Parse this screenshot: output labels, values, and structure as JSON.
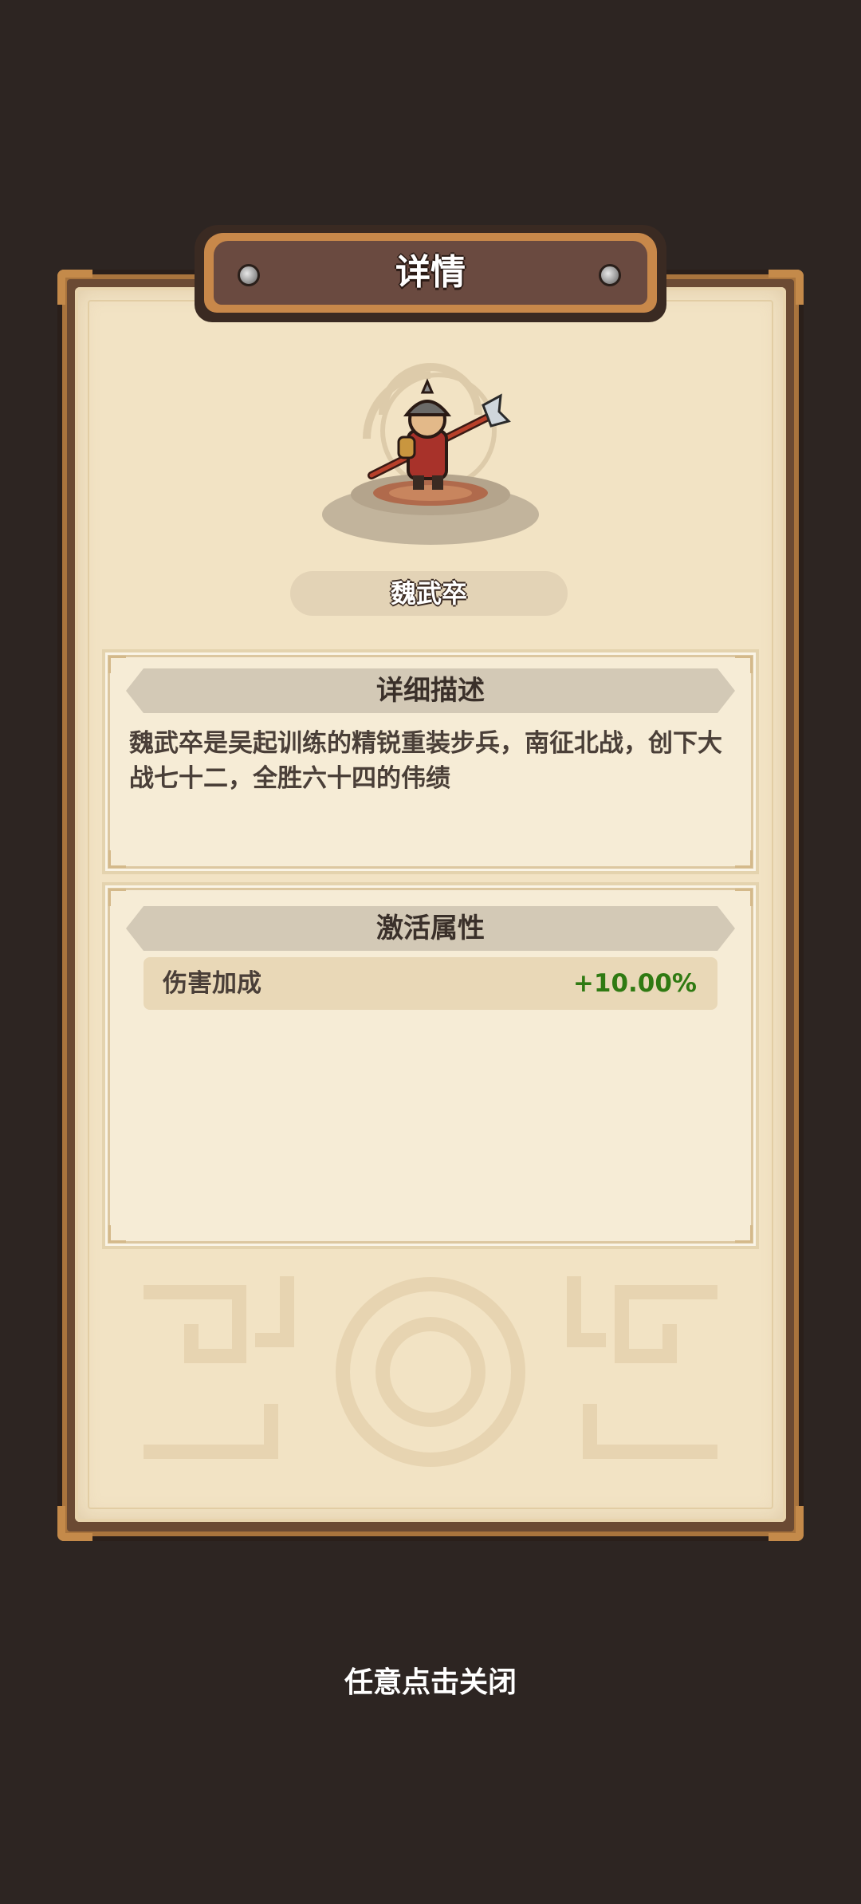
{
  "dialog": {
    "title": "详情"
  },
  "unit": {
    "name": "魏武卒",
    "portrait_icon": "spear-soldier-icon"
  },
  "description_section": {
    "heading": "详细描述",
    "text": "魏武卒是吴起训练的精锐重装步兵，南征北战，创下大战七十二，全胜六十四的伟绩"
  },
  "attributes_section": {
    "heading": "激活属性",
    "rows": [
      {
        "label": "伤害加成",
        "value": "+10.00%"
      }
    ]
  },
  "footer": {
    "close_hint": "任意点击关闭"
  },
  "colors": {
    "background": "#2d2522",
    "panel": "#f2e3c4",
    "frame": "#6b4a33",
    "accent_value": "#2f7a12"
  }
}
